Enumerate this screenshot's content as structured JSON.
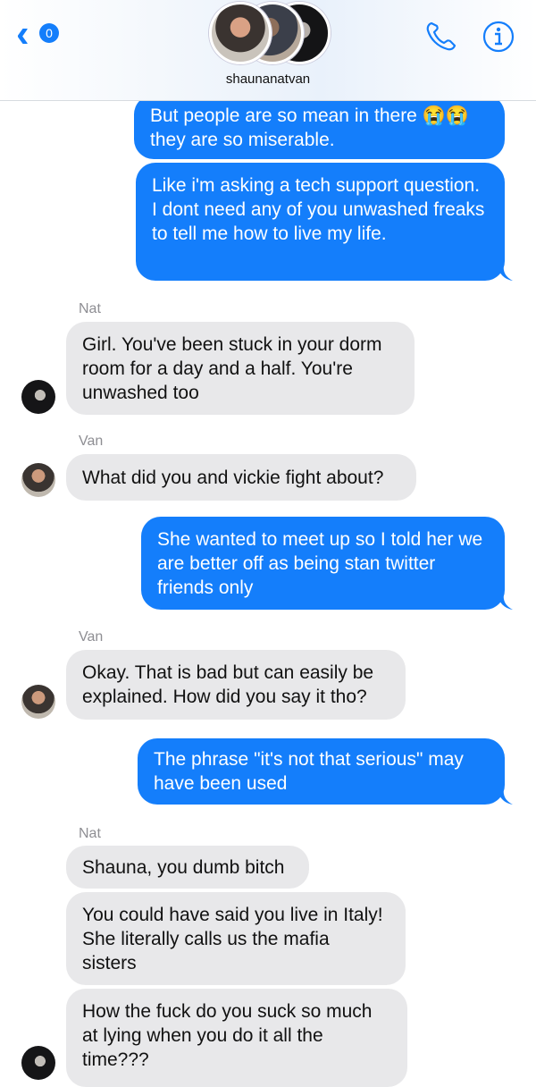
{
  "header": {
    "back_badge": "0",
    "chat_name": "shaunanatvan"
  },
  "messages": [
    {
      "id": "m1",
      "direction": "outgoing",
      "text": "But people are so mean in there 😭😭 they are so miserable."
    },
    {
      "id": "m2",
      "direction": "outgoing",
      "text": "Like i'm asking a tech support question. I dont need any of you unwashed freaks to tell me how to live my life."
    },
    {
      "id": "m3",
      "direction": "incoming",
      "sender": "Nat",
      "text": "Girl. You've been stuck in your dorm room for a day and a half. You're unwashed too"
    },
    {
      "id": "m4",
      "direction": "incoming",
      "sender": "Van",
      "text": "What did you and vickie fight about?"
    },
    {
      "id": "m5",
      "direction": "outgoing",
      "text": "She wanted to meet up so I told her we are better off as being stan twitter friends only"
    },
    {
      "id": "m6",
      "direction": "incoming",
      "sender": "Van",
      "text": "Okay. That is bad but can easily be explained. How did you say it tho?"
    },
    {
      "id": "m7",
      "direction": "outgoing",
      "text": "The phrase \"it's not that serious\" may have been used"
    },
    {
      "id": "m8",
      "direction": "incoming",
      "sender": "Nat",
      "text": "Shauna, you dumb bitch"
    },
    {
      "id": "m9",
      "direction": "incoming",
      "sender": "Nat",
      "text": "You could have said you live in Italy! She literally calls us the mafia sisters"
    },
    {
      "id": "m10",
      "direction": "incoming",
      "sender": "Nat",
      "text": "How the fuck do you suck so much at lying when you do it all the time???"
    }
  ],
  "colors": {
    "outgoing_bubble": "#147efb",
    "incoming_bubble": "#e8e8ea",
    "accent": "#147efb"
  }
}
